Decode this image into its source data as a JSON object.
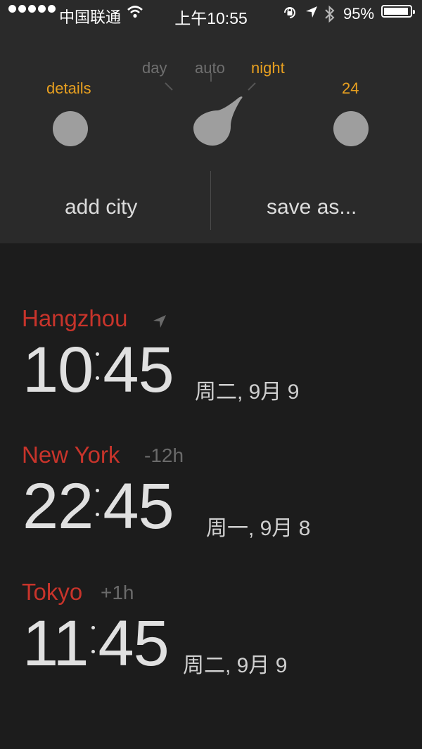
{
  "status_bar": {
    "carrier": "中国联通",
    "time": "上午10:55",
    "battery": "95%",
    "battery_level": 0.95
  },
  "settings": {
    "details_label": "details",
    "format_label": "24",
    "mode_options": [
      "day",
      "auto",
      "night"
    ],
    "mode_selected": "night",
    "add_city_label": "add city",
    "save_as_label": "save as..."
  },
  "cities": [
    {
      "name": "Hangzhou",
      "offset": "",
      "hours": "10",
      "minutes": "45",
      "date": "周二, 9月 9",
      "current_location": true
    },
    {
      "name": "New York",
      "offset": "-12h",
      "hours": "22",
      "minutes": "45",
      "date": "周一, 9月 8",
      "current_location": false
    },
    {
      "name": "Tokyo",
      "offset": "+1h",
      "hours": "11",
      "minutes": "45",
      "date": "周二, 9月 9",
      "current_location": false
    }
  ],
  "colors": {
    "accent": "#e8a020",
    "city": "#c8342b",
    "panel": "#2a2a2a",
    "background": "#1c1c1c"
  }
}
